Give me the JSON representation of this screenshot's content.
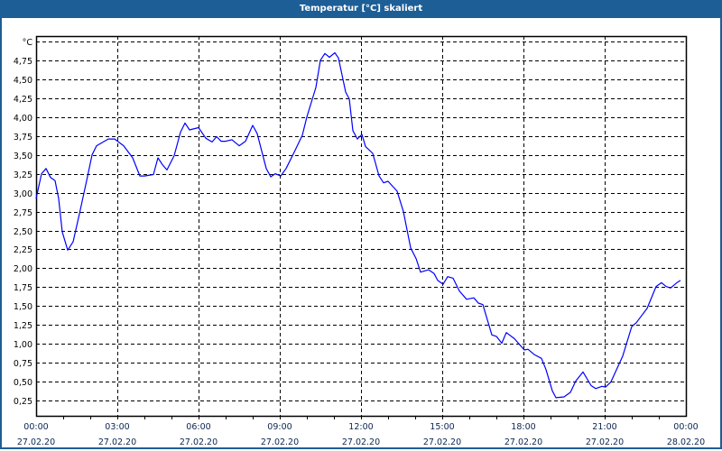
{
  "window": {
    "title": "Temperatur [°C] skaliert"
  },
  "chart_data": {
    "type": "line",
    "title": "Temperatur [°C] skaliert",
    "ylabel": "°C",
    "xlabel": "",
    "ylim": [
      0.05,
      5.07
    ],
    "xlim_minutes": [
      0,
      1440
    ],
    "grid": true,
    "line_color": "#0000ff",
    "y_ticks": [
      {
        "v": 0.25,
        "label": "0,25"
      },
      {
        "v": 0.5,
        "label": "0,50"
      },
      {
        "v": 0.75,
        "label": "0,75"
      },
      {
        "v": 1.0,
        "label": "1,00"
      },
      {
        "v": 1.25,
        "label": "1,25"
      },
      {
        "v": 1.5,
        "label": "1,50"
      },
      {
        "v": 1.75,
        "label": "1,75"
      },
      {
        "v": 2.0,
        "label": "2,00"
      },
      {
        "v": 2.25,
        "label": "2,25"
      },
      {
        "v": 2.5,
        "label": "2,50"
      },
      {
        "v": 2.75,
        "label": "2,75"
      },
      {
        "v": 3.0,
        "label": "3,00"
      },
      {
        "v": 3.25,
        "label": "3,25"
      },
      {
        "v": 3.5,
        "label": "3,50"
      },
      {
        "v": 3.75,
        "label": "3,75"
      },
      {
        "v": 4.0,
        "label": "4,00"
      },
      {
        "v": 4.25,
        "label": "4,25"
      },
      {
        "v": 4.5,
        "label": "4,50"
      },
      {
        "v": 4.75,
        "label": "4,75"
      },
      {
        "v": 5.0,
        "label": "°C"
      }
    ],
    "x_ticks": [
      {
        "m": 0,
        "time": "00:00",
        "date": "27.02.20"
      },
      {
        "m": 180,
        "time": "03:00",
        "date": "27.02.20"
      },
      {
        "m": 360,
        "time": "06:00",
        "date": "27.02.20"
      },
      {
        "m": 540,
        "time": "09:00",
        "date": "27.02.20"
      },
      {
        "m": 720,
        "time": "12:00",
        "date": "27.02.20"
      },
      {
        "m": 900,
        "time": "15:00",
        "date": "27.02.20"
      },
      {
        "m": 1080,
        "time": "18:00",
        "date": "27.02.20"
      },
      {
        "m": 1260,
        "time": "21:00",
        "date": "27.02.20"
      },
      {
        "m": 1440,
        "time": "00:00",
        "date": "28.02.20"
      }
    ],
    "series": [
      {
        "name": "Temperatur",
        "minutes": [
          0,
          12,
          22,
          32,
          42,
          50,
          58,
          70,
          82,
          96,
          112,
          124,
          134,
          160,
          174,
          194,
          214,
          230,
          240,
          260,
          270,
          280,
          290,
          306,
          320,
          330,
          340,
          360,
          376,
          390,
          400,
          410,
          420,
          434,
          450,
          464,
          480,
          490,
          510,
          520,
          530,
          542,
          554,
          574,
          590,
          600,
          620,
          630,
          640,
          650,
          662,
          670,
          686,
          694,
          702,
          712,
          722,
          730,
          746,
          760,
          770,
          780,
          800,
          814,
          830,
          842,
          852,
          870,
          882,
          890,
          902,
          912,
          924,
          938,
          954,
          970,
          980,
          990,
          1010,
          1020,
          1032,
          1042,
          1060,
          1082,
          1090,
          1104,
          1120,
          1130,
          1144,
          1152,
          1170,
          1184,
          1196,
          1212,
          1230,
          1240,
          1254,
          1262,
          1274,
          1300,
          1320,
          1330,
          1354,
          1374,
          1386,
          1396,
          1406,
          1420,
          1428
        ],
        "values": [
          2.92,
          3.25,
          3.32,
          3.2,
          3.16,
          2.92,
          2.48,
          2.24,
          2.35,
          2.72,
          3.16,
          3.5,
          3.62,
          3.71,
          3.71,
          3.62,
          3.46,
          3.22,
          3.22,
          3.24,
          3.46,
          3.37,
          3.3,
          3.49,
          3.8,
          3.92,
          3.83,
          3.86,
          3.72,
          3.67,
          3.74,
          3.68,
          3.68,
          3.7,
          3.62,
          3.68,
          3.89,
          3.78,
          3.32,
          3.21,
          3.25,
          3.22,
          3.32,
          3.56,
          3.76,
          4.0,
          4.39,
          4.75,
          4.84,
          4.79,
          4.85,
          4.78,
          4.33,
          4.24,
          3.82,
          3.71,
          3.77,
          3.61,
          3.52,
          3.22,
          3.13,
          3.15,
          3.02,
          2.75,
          2.27,
          2.13,
          1.95,
          1.98,
          1.93,
          1.84,
          1.79,
          1.89,
          1.87,
          1.7,
          1.59,
          1.61,
          1.54,
          1.52,
          1.12,
          1.1,
          1.01,
          1.15,
          1.07,
          0.92,
          0.93,
          0.86,
          0.81,
          0.66,
          0.38,
          0.29,
          0.3,
          0.36,
          0.51,
          0.63,
          0.45,
          0.41,
          0.44,
          0.43,
          0.5,
          0.84,
          1.23,
          1.28,
          1.47,
          1.76,
          1.81,
          1.76,
          1.74,
          1.81,
          1.84
        ]
      }
    ]
  }
}
